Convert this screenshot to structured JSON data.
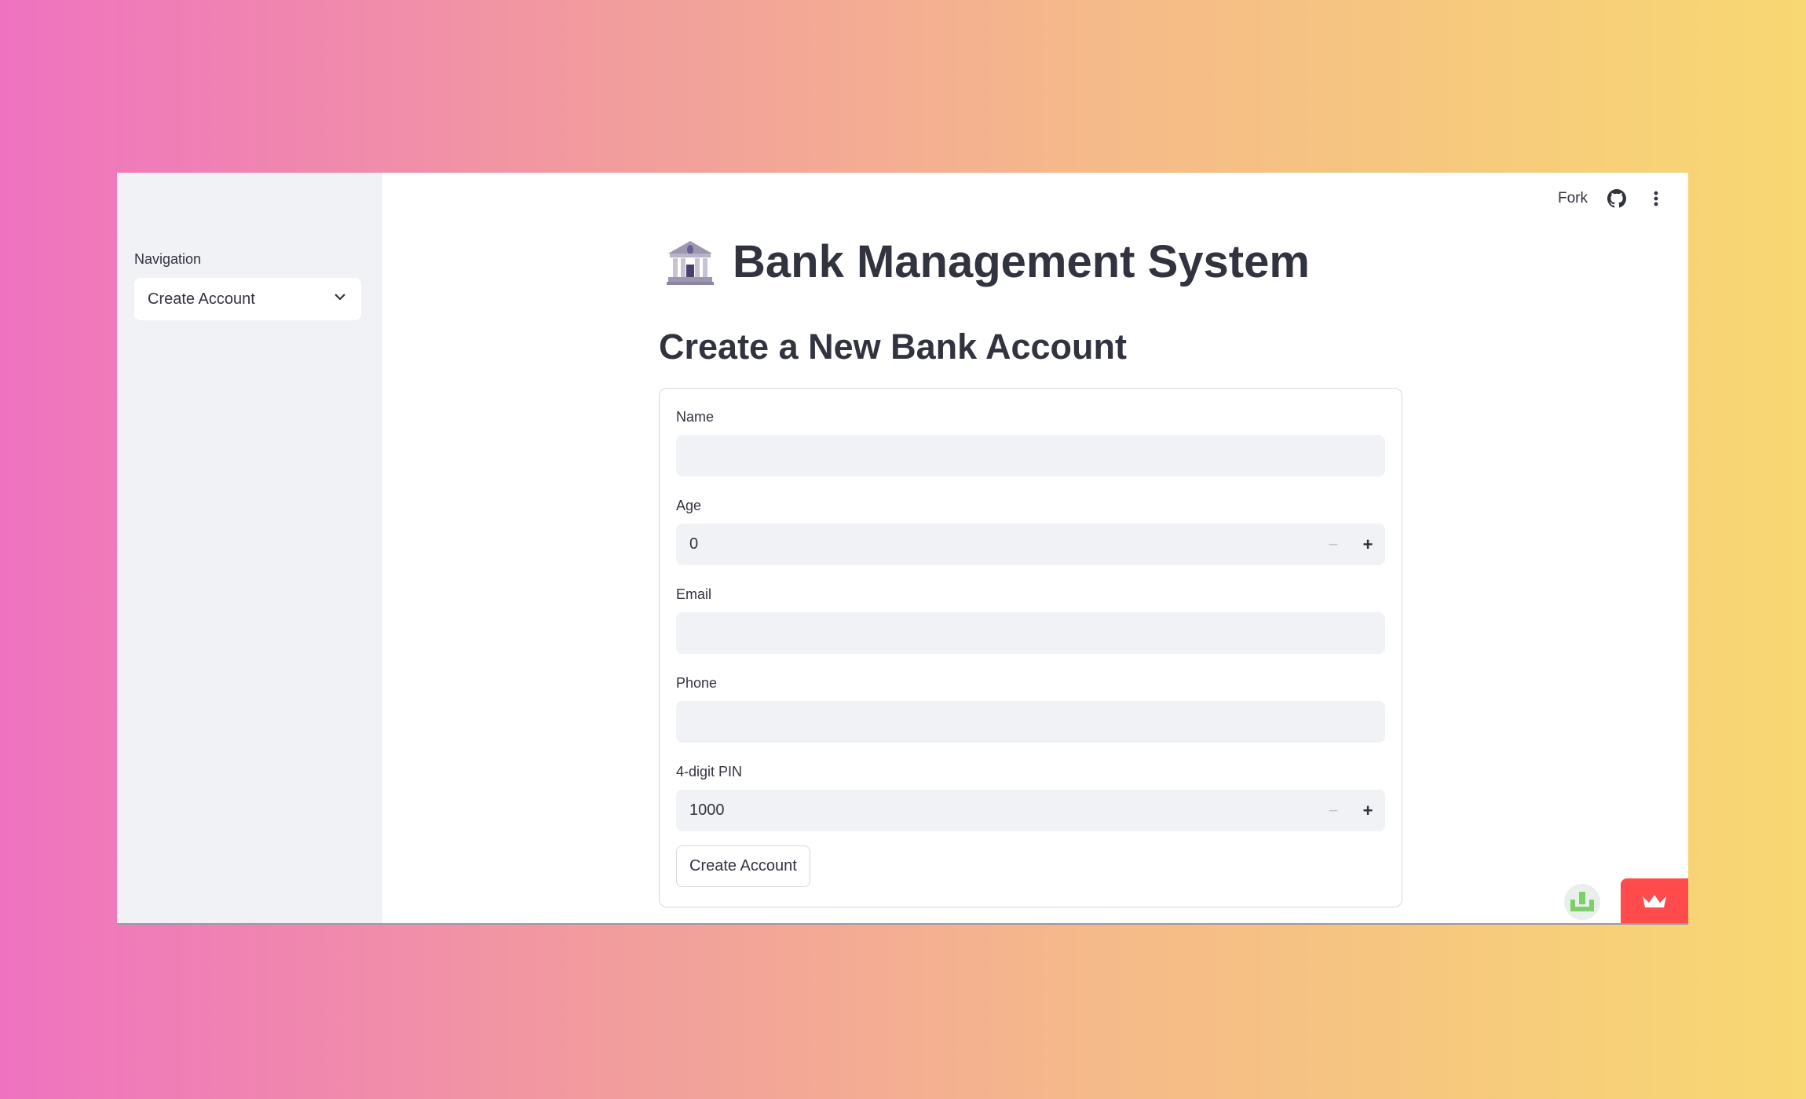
{
  "sidebar": {
    "nav_label": "Navigation",
    "selected_page": "Create Account"
  },
  "toolbar": {
    "fork_label": "Fork",
    "icons": [
      "github-icon",
      "more-vertical-icon"
    ]
  },
  "page": {
    "title": "Bank Management System",
    "title_icon": "bank-emoji",
    "subtitle": "Create a New Bank Account"
  },
  "form": {
    "name": {
      "label": "Name",
      "value": ""
    },
    "age": {
      "label": "Age",
      "value": "0"
    },
    "email": {
      "label": "Email",
      "value": ""
    },
    "phone": {
      "label": "Phone",
      "value": ""
    },
    "pin": {
      "label": "4-digit PIN",
      "value": "1000"
    },
    "submit_label": "Create Account"
  },
  "colors": {
    "accent_red": "#ff4b4b",
    "sidebar_bg": "#f0f2f6",
    "input_bg": "#f0f2f6",
    "text": "#31333f"
  }
}
